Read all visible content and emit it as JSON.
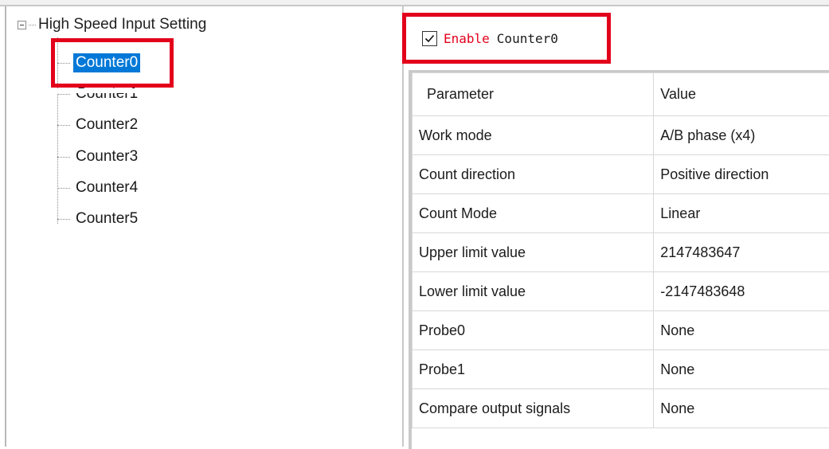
{
  "tree": {
    "root_label": "High Speed Input Setting",
    "items": [
      "Counter0",
      "Counter1",
      "Counter2",
      "Counter3",
      "Counter4",
      "Counter5"
    ],
    "selected_item": "Counter0"
  },
  "enable": {
    "checked": true,
    "label": "Enable",
    "counter_name": "Counter0"
  },
  "grid": {
    "headers": [
      "Parameter",
      "Value"
    ],
    "rows": [
      [
        "Work mode",
        "A/B phase (x4)"
      ],
      [
        "Count direction",
        "Positive direction"
      ],
      [
        "Count Mode",
        "Linear"
      ],
      [
        "Upper limit value",
        "2147483647"
      ],
      [
        "Lower limit value",
        "-2147483648"
      ],
      [
        "Probe0",
        "None"
      ],
      [
        "Probe1",
        "None"
      ],
      [
        "Compare output signals",
        "None"
      ]
    ]
  },
  "colors": {
    "highlight_box": "#e3001b",
    "selection": "#0078d7",
    "enable_text": "#e3001b"
  }
}
